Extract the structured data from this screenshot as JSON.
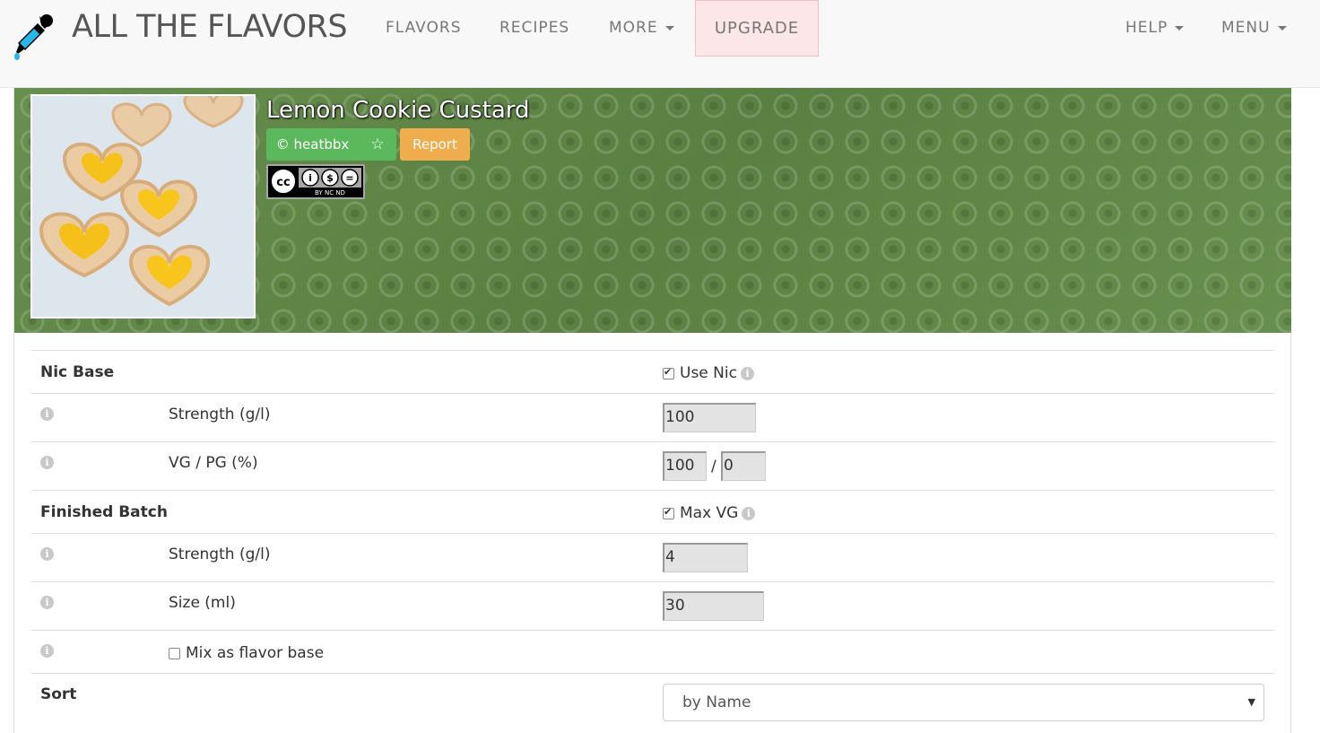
{
  "nav": {
    "brand": "ALL THE FLAVORS",
    "items": {
      "flavors": "FLAVORS",
      "recipes": "RECIPES",
      "more": "MORE",
      "upgrade": "UPGRADE",
      "help": "HELP",
      "menu": "MENU"
    }
  },
  "recipe": {
    "title": "Lemon Cookie Custard",
    "author_button": "© heatbbx",
    "star_icon": "star-icon",
    "report_button": "Report",
    "license_badge_text": "BY NC ND"
  },
  "settings": {
    "nic_base": {
      "label": "Nic Base",
      "use_nic_label": "Use Nic",
      "use_nic_checked": true,
      "strength_label": "Strength (g/l)",
      "strength_value": "100",
      "vgpg_label": "VG / PG (%)",
      "vg_value": "100",
      "pg_value": "0",
      "separator": "/"
    },
    "finished_batch": {
      "label": "Finished Batch",
      "max_vg_label": "Max VG",
      "max_vg_checked": true,
      "strength_label": "Strength (g/l)",
      "strength_value": "4",
      "size_label": "Size (ml)",
      "size_value": "30",
      "flavor_base_label": "Mix as flavor base",
      "flavor_base_checked": false
    },
    "sort": {
      "label": "Sort",
      "selected": "by Name"
    }
  },
  "colors": {
    "success": "#5cb85c",
    "warning": "#f0ad4e",
    "banner": "#5e8446",
    "upgrade_bg": "#fde6e8"
  }
}
